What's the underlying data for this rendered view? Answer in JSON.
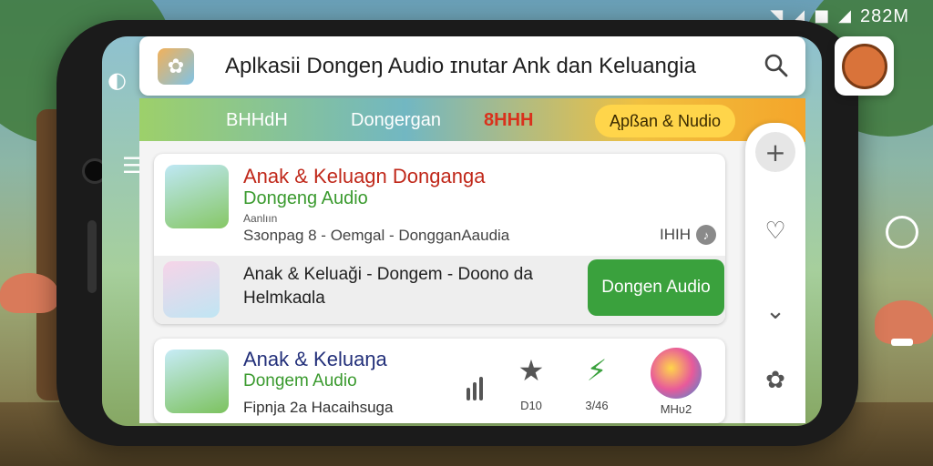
{
  "status_bar": {
    "time": "282M",
    "wifi_icon": "wifi-icon",
    "signal_icon": "signal-icon",
    "battery_icon": "battery-icon"
  },
  "search": {
    "title": "Aplkasii Dongeŋ Audio ɪnutar Ank dan Keluangia"
  },
  "banner": {
    "tabs": [
      "BHHdH",
      "Dongergan",
      "8HHH"
    ],
    "pill": "Ąpßan & Nudio"
  },
  "card1": {
    "title": "Anak & Keluagn Donganga",
    "subtitle": "Dongeng Audio",
    "tiny": "Aanlıın",
    "meta": "Sзonpag  8 - Oemgal - DongganAaudia",
    "right_text": "IHIH",
    "strip_text": "Anak & Keluaği - Dongem - Doono da Helmkaɑla",
    "button": "Dongen Audio"
  },
  "card2": {
    "title": "Anak & Keluaŋa",
    "subtitle": "Dongem Audio",
    "meta": "Fipnja  2a  Hacaihsuga",
    "stats": [
      {
        "icon": "star-icon",
        "label": "D10"
      },
      {
        "icon": "lightning-icon",
        "label": "3/46"
      }
    ],
    "app_label": "MHʋ2"
  },
  "colors": {
    "accent_green": "#3aa13d",
    "title_red": "#c0281a",
    "title_navy": "#23307a"
  }
}
